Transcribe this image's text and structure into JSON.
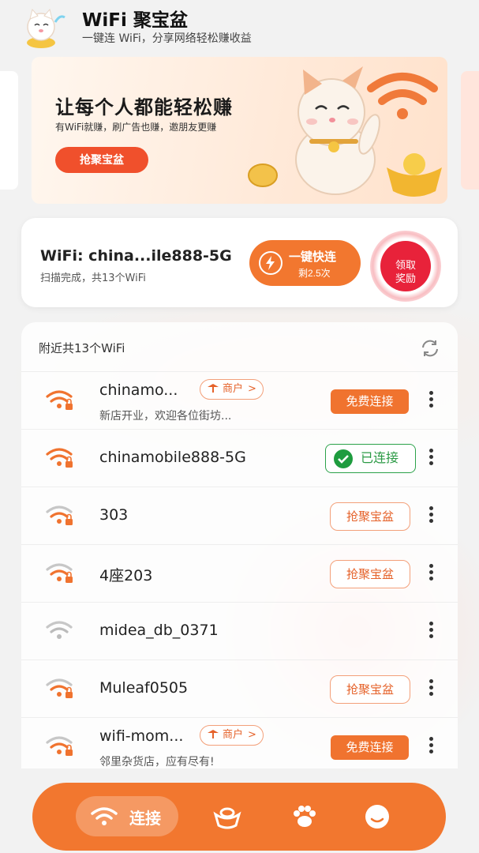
{
  "header": {
    "title": "WiFi 聚宝盆",
    "subtitle": "一键连 WiFi，分享网络轻松赚收益",
    "logo_icon": "cat-logo-icon"
  },
  "banner": {
    "title": "让每个人都能轻松赚",
    "subtitle": "有WiFi就赚，刷广告也赚，邀朋友更赚",
    "button": "抢聚宝盆"
  },
  "scan": {
    "name": "WiFi: china...ile888-5G",
    "status": "扫描完成，共13个WiFi",
    "quick_label": "一键快连",
    "quick_sub": "剩2.5次",
    "reward_line1": "领取",
    "reward_line2": "奖励"
  },
  "list": {
    "heading": "附近共13个WiFi",
    "rows": [
      {
        "ssid": "chinamo...",
        "merchant": "商户",
        "desc": "新店开业，欢迎各位街坊...",
        "action": "免费连接",
        "action_type": "free",
        "signal_color": "#f0732f",
        "lock": true
      },
      {
        "ssid": "chinamobile888-5G",
        "merchant": "",
        "desc": "",
        "action": "已连接",
        "action_type": "connected",
        "signal_color": "#f0732f",
        "lock": true
      },
      {
        "ssid": "303",
        "merchant": "",
        "desc": "",
        "action": "抢聚宝盆",
        "action_type": "grab",
        "signal_color": "#f0732f",
        "lock": true
      },
      {
        "ssid": "4座203",
        "merchant": "",
        "desc": "",
        "action": "抢聚宝盆",
        "action_type": "grab",
        "signal_color": "#f0732f",
        "lock": true
      },
      {
        "ssid": "midea_db_0371",
        "merchant": "",
        "desc": "",
        "action": "",
        "action_type": "none",
        "signal_color": "#bbbbbb",
        "lock": false
      },
      {
        "ssid": "Muleaf0505",
        "merchant": "",
        "desc": "",
        "action": "抢聚宝盆",
        "action_type": "grab",
        "signal_color": "#f0732f",
        "lock": true
      },
      {
        "ssid": "wifi-mom...",
        "merchant": "商户",
        "desc": "邻里杂货店，应有尽有!",
        "action": "免费连接",
        "action_type": "free",
        "signal_color": "#f0732f",
        "lock": true
      }
    ]
  },
  "nav": {
    "active_label": "连接",
    "items": [
      "wifi-icon",
      "gold-ingot-icon",
      "paw-icon",
      "face-icon"
    ]
  },
  "colors": {
    "accent": "#f2772f",
    "red": "#e8223a",
    "green": "#1e9c3f"
  }
}
